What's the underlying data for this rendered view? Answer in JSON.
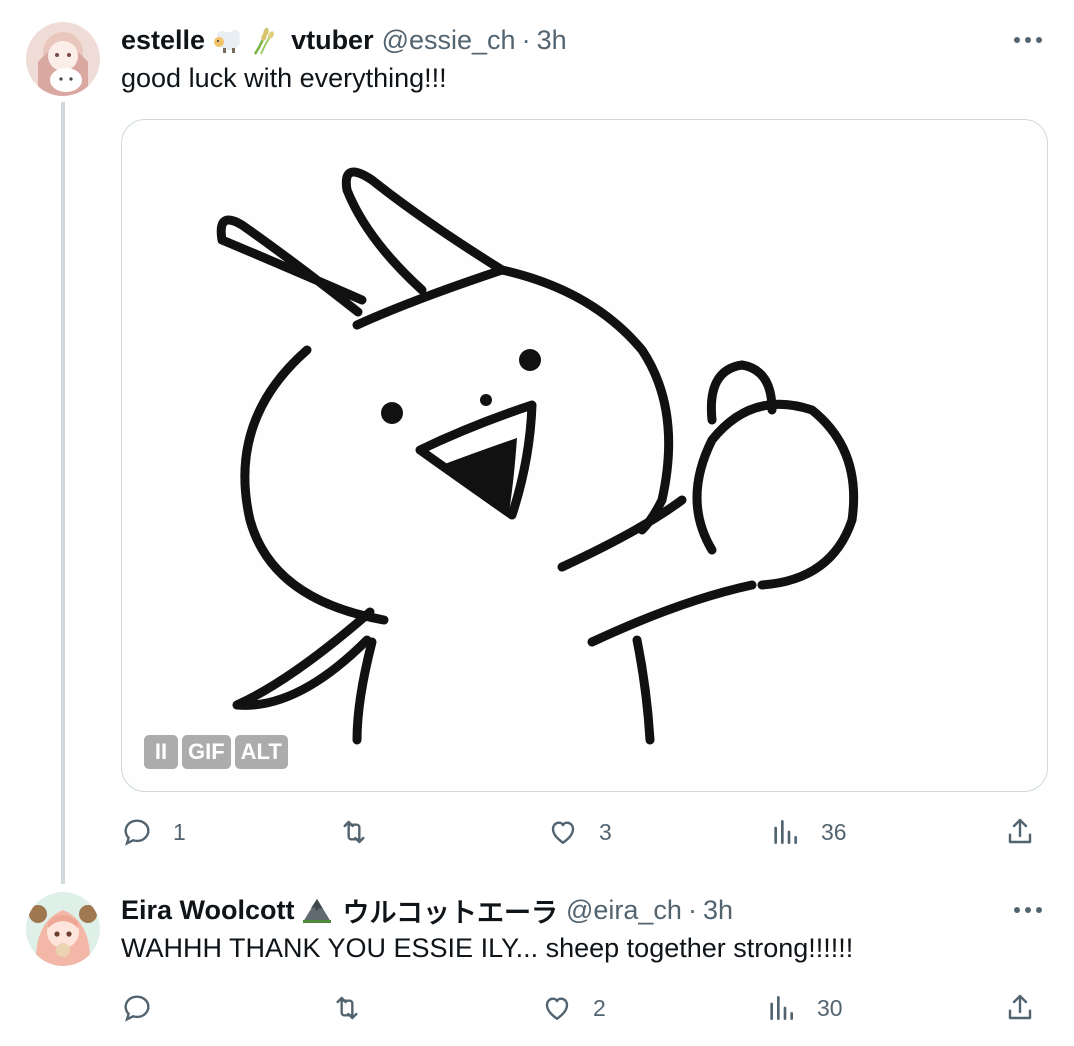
{
  "tweets": [
    {
      "display_name": "estelle",
      "name_suffix": "vtuber",
      "handle": "@essie_ch",
      "separator": "·",
      "time": "3h",
      "text": "good luck with everything!!!",
      "media": {
        "type": "gif",
        "badges": {
          "pause": "II",
          "gif": "GIF",
          "alt": "ALT"
        }
      },
      "emojis": [
        "sheep-emoji",
        "rice-plant-emoji"
      ],
      "actions": {
        "replies": "1",
        "retweets": "",
        "likes": "3",
        "views": "36"
      }
    },
    {
      "display_name": "Eira Woolcott",
      "name_suffix": "ウルコットエーラ",
      "handle": "@eira_ch",
      "separator": "·",
      "time": "3h",
      "text": "WAHHH THANK YOU ESSIE ILY... sheep together strong!!!!!!",
      "emojis": [
        "mountain-emoji"
      ],
      "actions": {
        "replies": "",
        "retweets": "",
        "likes": "2",
        "views": "30"
      }
    }
  ],
  "colors": {
    "text": "#0f1419",
    "secondary": "#536471",
    "border": "#cfd9de",
    "badge_bg": "rgba(0,0,0,0.32)"
  }
}
